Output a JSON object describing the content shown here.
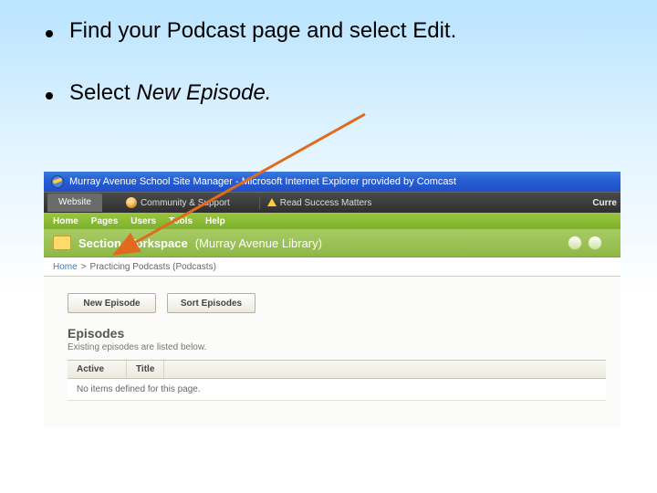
{
  "bullets": {
    "b1": "Find your Podcast page and select Edit.",
    "b2_prefix": "Select ",
    "b2_em": "New Episode."
  },
  "titlebar": {
    "text": "Murray Avenue School Site Manager - Microsoft Internet Explorer provided by Comcast"
  },
  "toolbar": {
    "tab": "Website",
    "community": "Community & Support",
    "success": "Read Success Matters",
    "right": "Curre"
  },
  "greenbar1": {
    "items": [
      "Home",
      "Pages",
      "Users",
      "Tools",
      "Help"
    ]
  },
  "greenbar2": {
    "label": "Section Workspace",
    "context": "(Murray Avenue Library)"
  },
  "breadcrumb": {
    "home": "Home",
    "final": "Practicing Podcasts (Podcasts)"
  },
  "buttons": {
    "new_episode": "New Episode",
    "sort_episodes": "Sort Episodes"
  },
  "episodes": {
    "heading": "Episodes",
    "sub": "Existing episodes are listed below.",
    "col_active": "Active",
    "col_title": "Title",
    "empty": "No items defined for this page."
  }
}
